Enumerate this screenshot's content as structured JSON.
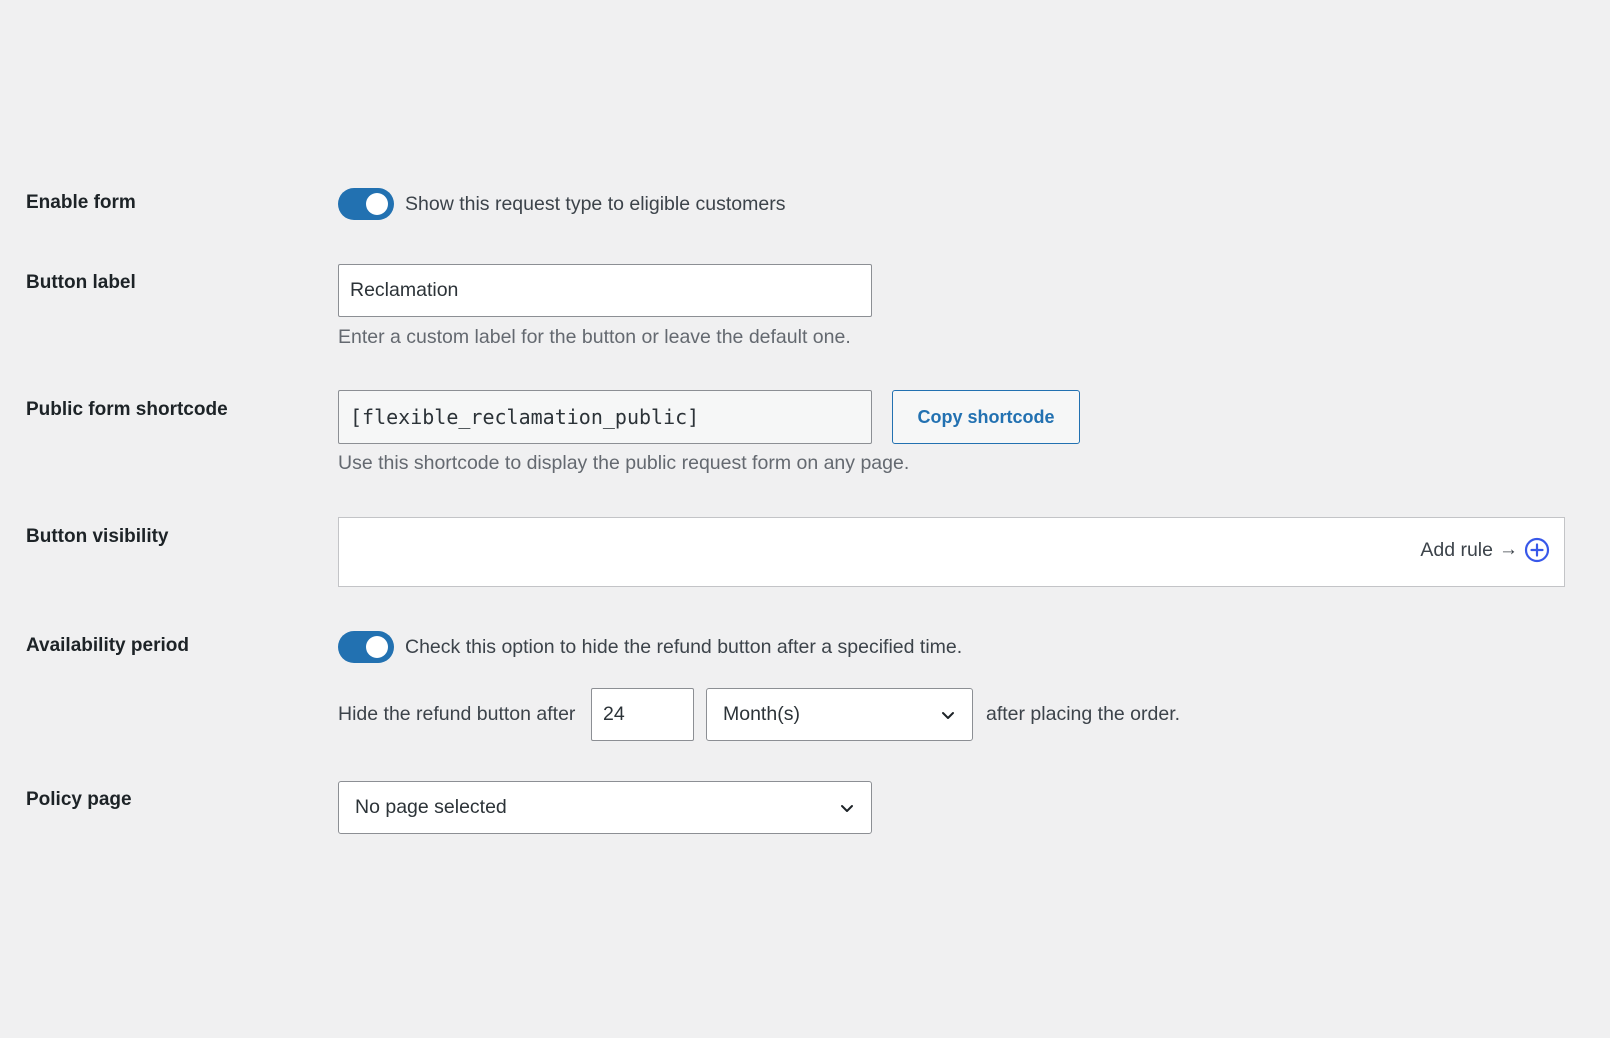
{
  "enable_form": {
    "label": "Enable form",
    "toggle_on": true,
    "description": "Show this request type to eligible customers"
  },
  "button_label": {
    "label": "Button label",
    "value": "Reclamation",
    "help": "Enter a custom label for the button or leave the default one."
  },
  "public_shortcode": {
    "label": "Public form shortcode",
    "value": "[flexible_reclamation_public]",
    "copy_button": "Copy shortcode",
    "help": "Use this shortcode to display the public request form on any page."
  },
  "button_visibility": {
    "label": "Button visibility",
    "add_rule": "Add rule",
    "arrow": "→",
    "add_icon": "plus-circle-icon"
  },
  "availability_period": {
    "label": "Availability period",
    "toggle_on": true,
    "description": "Check this option to hide the refund button after a specified time.",
    "prefix": "Hide the refund button after",
    "amount": "24",
    "unit": "Month(s)",
    "suffix": "after placing the order."
  },
  "policy_page": {
    "label": "Policy page",
    "selected": "No page selected"
  },
  "colors": {
    "accent": "#2271b1",
    "background": "#f0f0f1",
    "label_text": "#1d2327",
    "help_text": "#646970",
    "add_rule_icon": "#3858e9"
  }
}
